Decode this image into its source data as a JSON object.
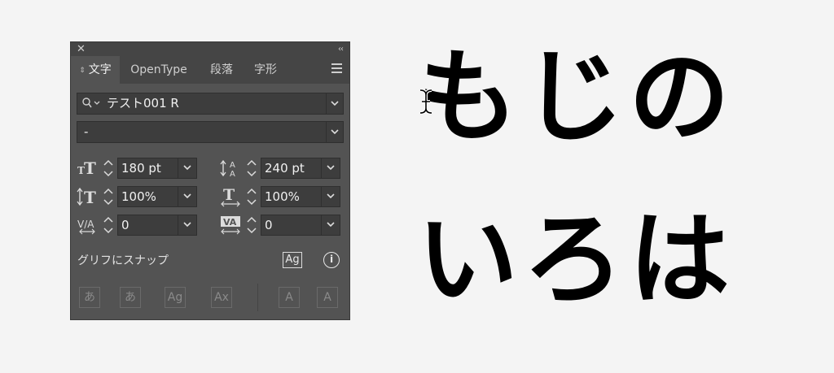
{
  "panel": {
    "close_glyph": "✕",
    "collapse_glyph": "‹‹",
    "tabs": [
      {
        "label": "文字"
      },
      {
        "label": "OpenType"
      },
      {
        "label": "段落"
      },
      {
        "label": "字形"
      }
    ],
    "font_family": "テスト001 R",
    "font_style": "-",
    "font_size": "180 pt",
    "leading": "240 pt",
    "vertical_scale": "100%",
    "horizontal_scale": "100%",
    "kerning": "0",
    "tracking": "0",
    "snap_label": "グリフにスナップ",
    "glyph_buttons": [
      {
        "label": "あ"
      },
      {
        "label": "あ"
      },
      {
        "label": "Ag"
      },
      {
        "label": "Ax"
      },
      {
        "label": "A"
      },
      {
        "label": "A"
      }
    ],
    "snap_icon_label": "Ag",
    "info_glyph": "i"
  },
  "canvas": {
    "line1": "もじの",
    "line2": "いろは"
  }
}
